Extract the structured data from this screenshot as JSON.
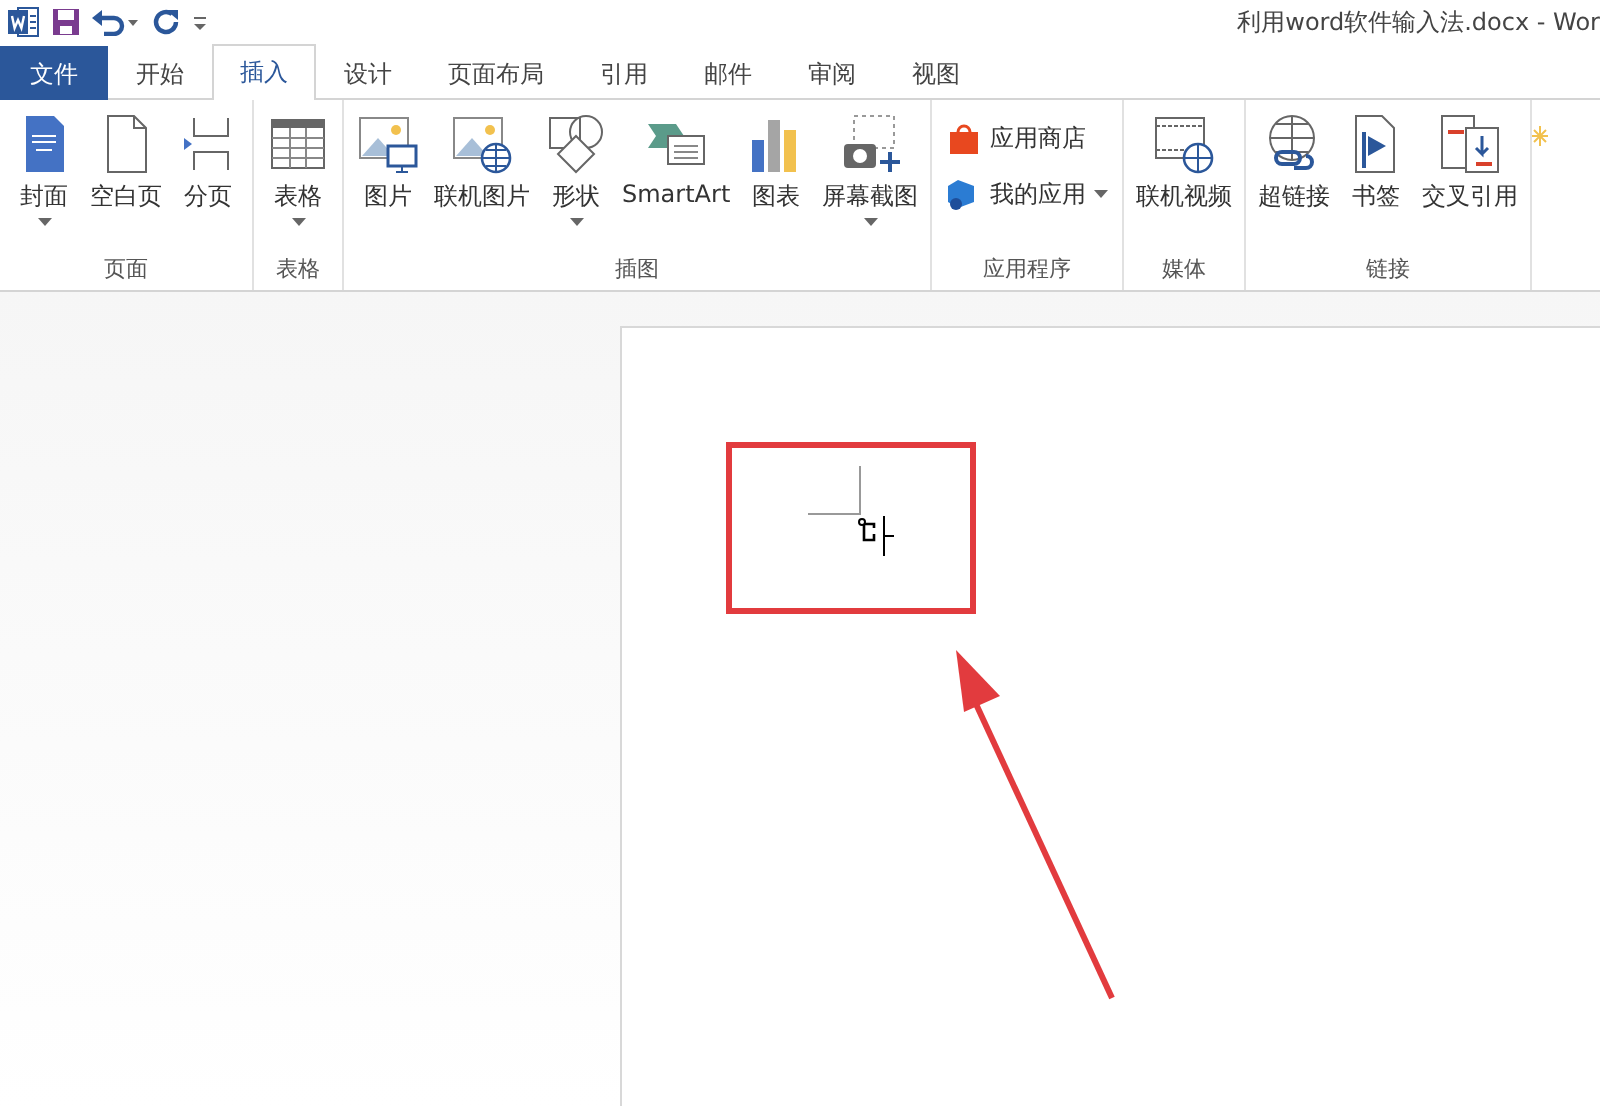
{
  "window": {
    "title": "利用word软件输入法.docx - Wor"
  },
  "tabs": [
    {
      "label": "文件",
      "kind": "file",
      "selected": false
    },
    {
      "label": "开始",
      "kind": "tab",
      "selected": false
    },
    {
      "label": "插入",
      "kind": "tab",
      "selected": true
    },
    {
      "label": "设计",
      "kind": "tab",
      "selected": false
    },
    {
      "label": "页面布局",
      "kind": "tab",
      "selected": false
    },
    {
      "label": "引用",
      "kind": "tab",
      "selected": false
    },
    {
      "label": "邮件",
      "kind": "tab",
      "selected": false
    },
    {
      "label": "审阅",
      "kind": "tab",
      "selected": false
    },
    {
      "label": "视图",
      "kind": "tab",
      "selected": false
    }
  ],
  "ribbon_groups": [
    {
      "label": "页面",
      "buttons": [
        {
          "label": "封面",
          "kind": "large",
          "dropdown": true
        },
        {
          "label": "空白页",
          "kind": "large",
          "dropdown": false
        },
        {
          "label": "分页",
          "kind": "large",
          "dropdown": false
        }
      ]
    },
    {
      "label": "表格",
      "buttons": [
        {
          "label": "表格",
          "kind": "large",
          "dropdown": true
        }
      ]
    },
    {
      "label": "插图",
      "buttons": [
        {
          "label": "图片",
          "kind": "large",
          "dropdown": false
        },
        {
          "label": "联机图片",
          "kind": "large",
          "dropdown": false
        },
        {
          "label": "形状",
          "kind": "large",
          "dropdown": true
        },
        {
          "label": "SmartArt",
          "kind": "large",
          "dropdown": false
        },
        {
          "label": "图表",
          "kind": "large",
          "dropdown": false
        },
        {
          "label": "屏幕截图",
          "kind": "large",
          "dropdown": true
        }
      ]
    },
    {
      "label": "应用程序",
      "buttons": [
        {
          "label": "应用商店",
          "kind": "small",
          "dropdown": false
        },
        {
          "label": "我的应用",
          "kind": "small",
          "dropdown": true
        }
      ]
    },
    {
      "label": "媒体",
      "buttons": [
        {
          "label": "联机视频",
          "kind": "large",
          "dropdown": false
        }
      ]
    },
    {
      "label": "链接",
      "buttons": [
        {
          "label": "超链接",
          "kind": "large",
          "dropdown": false
        },
        {
          "label": "书签",
          "kind": "large",
          "dropdown": false
        },
        {
          "label": "交叉引用",
          "kind": "large",
          "dropdown": false
        }
      ]
    }
  ]
}
